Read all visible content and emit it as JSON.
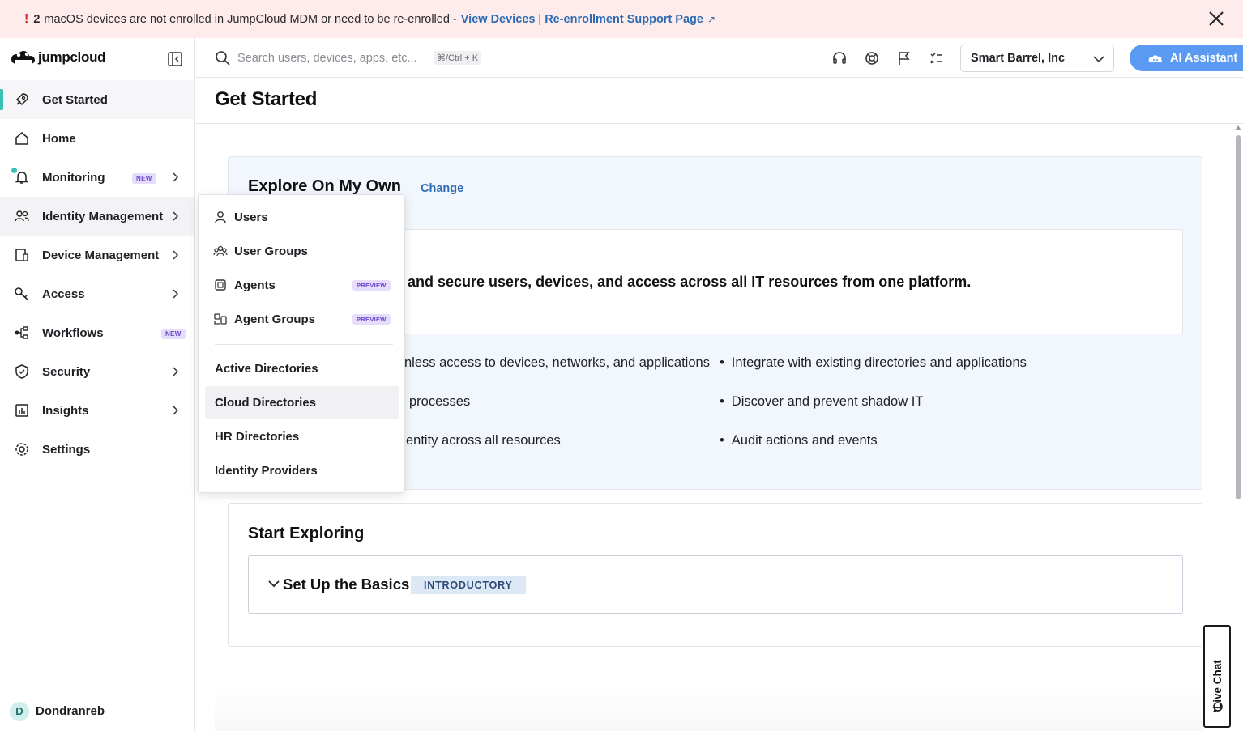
{
  "banner": {
    "count": "2",
    "message": "macOS devices are not enrolled in JumpCloud MDM or need to be re-enrolled -",
    "link_view_devices": "View Devices",
    "separator": "|",
    "link_support": "Re-enrollment Support Page"
  },
  "brand": {
    "name": "jumpcloud"
  },
  "sidebar": {
    "items": [
      {
        "label": "Get Started"
      },
      {
        "label": "Home"
      },
      {
        "label": "Monitoring",
        "badge": "NEW"
      },
      {
        "label": "Identity Management"
      },
      {
        "label": "Device Management"
      },
      {
        "label": "Access"
      },
      {
        "label": "Workflows",
        "badge": "NEW"
      },
      {
        "label": "Security"
      },
      {
        "label": "Insights"
      },
      {
        "label": "Settings"
      }
    ],
    "user": {
      "initial": "D",
      "name": "Dondranreb"
    }
  },
  "header": {
    "search_placeholder": "Search users, devices, apps, etc...",
    "shortcut": "⌘/Ctrl + K",
    "org": "Smart Barrel, Inc",
    "ai_button": "AI Assistant"
  },
  "main": {
    "title": "Get Started",
    "explore": {
      "title": "Explore On My Own",
      "change": "Change",
      "tagline": "and secure users, devices, and access across all IT resources from one platform.",
      "bullets_left": [
        "nless access to devices, networks, and applications",
        "processes",
        "entity across all resources"
      ],
      "bullets_right": [
        "Integrate with existing directories and applications",
        "Discover and prevent shadow IT",
        "Audit actions and events"
      ]
    },
    "start": {
      "title": "Start Exploring",
      "basics_title": "Set Up the Basics",
      "basics_badge": "INTRODUCTORY"
    },
    "live_chat": "Live Chat"
  },
  "flyout": {
    "items_icon": [
      {
        "label": "Users"
      },
      {
        "label": "User Groups"
      },
      {
        "label": "Agents",
        "badge": "PREVIEW"
      },
      {
        "label": "Agent Groups",
        "badge": "PREVIEW"
      }
    ],
    "items_plain": [
      {
        "label": "Active Directories"
      },
      {
        "label": "Cloud Directories"
      },
      {
        "label": "HR Directories"
      },
      {
        "label": "Identity Providers"
      }
    ]
  },
  "colors": {
    "accent_teal": "#39c2b5",
    "link_blue": "#2d6bb5",
    "ai_blue": "#5a9af3",
    "banner_bg": "#fdeceb",
    "badge_purple": "#6a46c8"
  }
}
